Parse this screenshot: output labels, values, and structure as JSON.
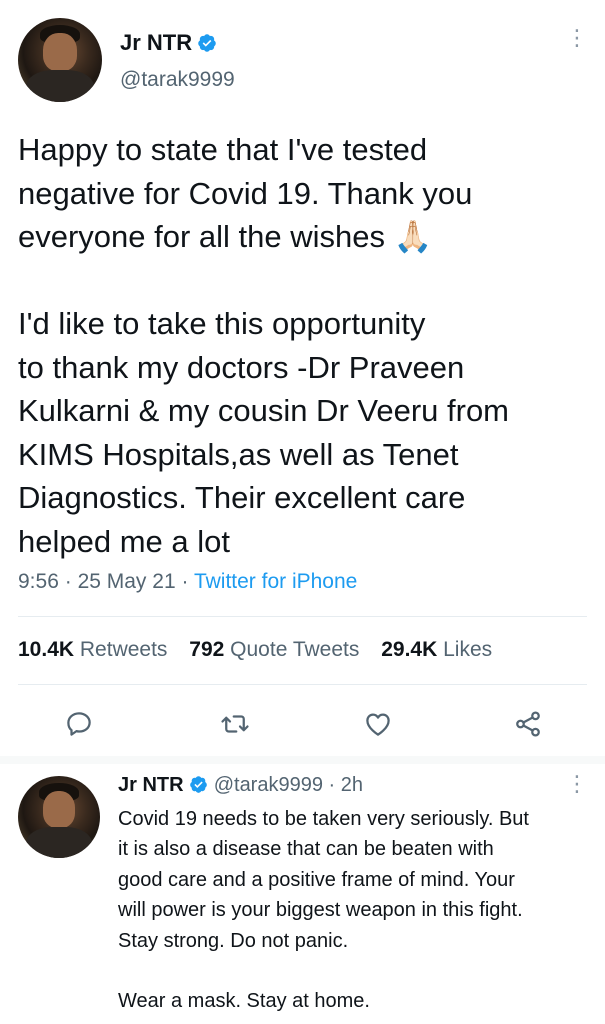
{
  "tweet": {
    "user_name": "Jr NTR",
    "handle": "@tarak9999",
    "text": "Happy to state that I've tested\nnegative for Covid 19. Thank you\neveryone for all the wishes 🙏🏻\n\nI'd like to take this opportunity\nto thank my doctors -Dr Praveen\nKulkarni & my cousin Dr Veeru from\nKIMS Hospitals,as well as Tenet\nDiagnostics. Their excellent care\nhelped me a lot",
    "time": "9:56",
    "sep": "·",
    "date": "25 May 21",
    "source": "Twitter for iPhone"
  },
  "stats": {
    "retweets_count": "10.4K",
    "retweets_label": "Retweets",
    "quotes_count": "792",
    "quotes_label": "Quote Tweets",
    "likes_count": "29.4K",
    "likes_label": "Likes"
  },
  "actions": [
    {
      "icon": "reply-icon"
    },
    {
      "icon": "retweet-icon"
    },
    {
      "icon": "like-icon"
    },
    {
      "icon": "share-icon"
    }
  ],
  "reply": {
    "user_name": "Jr NTR",
    "handle": "@tarak9999",
    "sep": "·",
    "time_ago": "2h",
    "text": "Covid 19 needs to be taken very seriously. But\nit is also a disease that can be beaten with\ngood care and a positive frame of mind. Your\nwill power is your biggest weapon in this fight.\nStay strong. Do not panic.\n\nWear a mask. Stay at home."
  },
  "colors": {
    "accent": "#1d9bf0",
    "secondary_text": "#536471",
    "primary_text": "#0f1419"
  }
}
